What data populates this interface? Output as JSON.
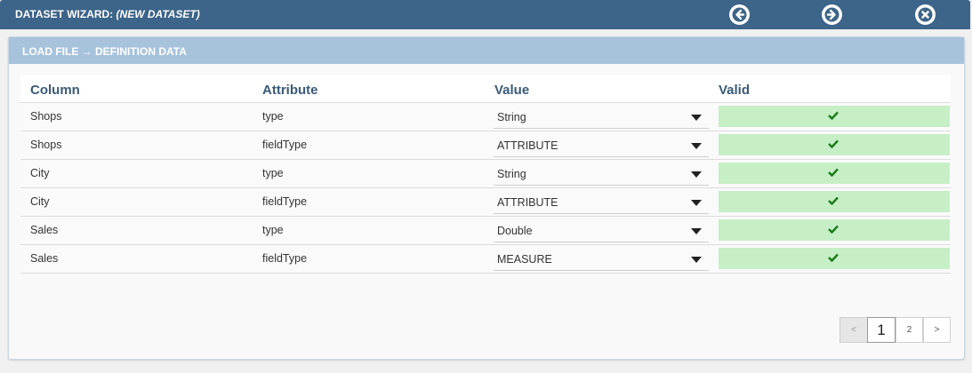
{
  "window": {
    "title_prefix": "DATASET WIZARD: ",
    "title_name": "(NEW DATASET)",
    "buttons": {
      "back_icon": "arrow-left-circle-icon",
      "next_icon": "arrow-right-circle-icon",
      "close_icon": "close-circle-icon"
    }
  },
  "panel": {
    "title": "LOAD FILE → DEFINITION DATA"
  },
  "table": {
    "headers": {
      "column": "Column",
      "attribute": "Attribute",
      "value": "Value",
      "valid": "Valid"
    },
    "rows": [
      {
        "column": "Shops",
        "attribute": "type",
        "value": "String"
      },
      {
        "column": "Shops",
        "attribute": "fieldType",
        "value": "ATTRIBUTE"
      },
      {
        "column": "City",
        "attribute": "type",
        "value": "String"
      },
      {
        "column": "City",
        "attribute": "fieldType",
        "value": "ATTRIBUTE"
      },
      {
        "column": "Sales",
        "attribute": "type",
        "value": "Double"
      },
      {
        "column": "Sales",
        "attribute": "fieldType",
        "value": "MEASURE"
      }
    ]
  },
  "pagination": {
    "prev": "<",
    "pages": [
      "1",
      "2"
    ],
    "next": ">",
    "current": "1"
  },
  "colors": {
    "titlebar": "#3d6489",
    "panel_header": "#a7c3dc",
    "valid_bg": "#c6efc6",
    "check": "#1a7a1a"
  }
}
